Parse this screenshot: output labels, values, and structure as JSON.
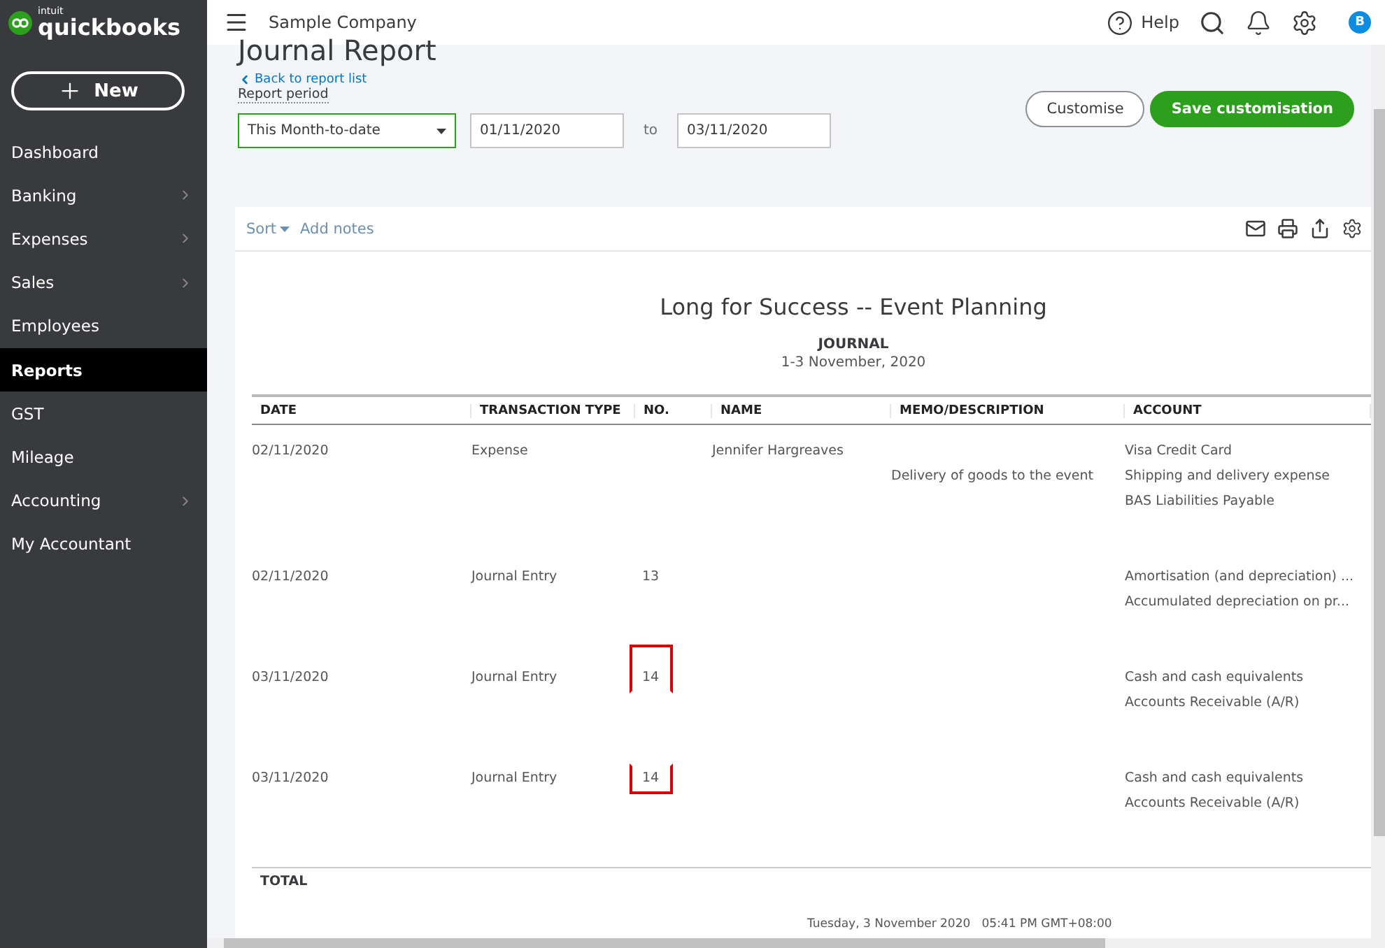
{
  "brand": {
    "small": "intuit",
    "name": "quickbooks"
  },
  "new_button": "New",
  "sidebar": {
    "items": [
      {
        "label": "Dashboard",
        "selected": false,
        "has_submenu": false
      },
      {
        "label": "Banking",
        "selected": false,
        "has_submenu": true
      },
      {
        "label": "Expenses",
        "selected": false,
        "has_submenu": true
      },
      {
        "label": "Sales",
        "selected": false,
        "has_submenu": true
      },
      {
        "label": "Employees",
        "selected": false,
        "has_submenu": false
      },
      {
        "label": "Reports",
        "selected": true,
        "has_submenu": false
      },
      {
        "label": "GST",
        "selected": false,
        "has_submenu": false
      },
      {
        "label": "Mileage",
        "selected": false,
        "has_submenu": false
      },
      {
        "label": "Accounting",
        "selected": false,
        "has_submenu": true
      },
      {
        "label": "My Accountant",
        "selected": false,
        "has_submenu": false
      }
    ]
  },
  "topbar": {
    "company": "Sample Company",
    "help": "Help",
    "avatar": "B"
  },
  "header": {
    "title": "Journal Report",
    "back_link": "Back to report list",
    "period_label": "Report period",
    "period_value": "This Month-to-date",
    "from": "01/11/2020",
    "to_label": "to",
    "to": "03/11/2020",
    "customise": "Customise",
    "save": "Save customisation"
  },
  "report_toolbar": {
    "sort": "Sort",
    "add_notes": "Add notes"
  },
  "report": {
    "company": "Long for Success -- Event Planning",
    "title": "JOURNAL",
    "period": "1-3 November, 2020",
    "columns": [
      "DATE",
      "TRANSACTION TYPE",
      "NO.",
      "NAME",
      "MEMO/DESCRIPTION",
      "ACCOUNT"
    ],
    "rows": [
      {
        "date": "02/11/2020",
        "type": "Expense",
        "marked": false,
        "lines": [
          {
            "name": "Jennifer Hargreaves",
            "account": "Visa Credit Card"
          },
          {
            "memo": "Delivery of goods to the event",
            "account": "Shipping and delivery expense"
          },
          {
            "account": "BAS Liabilities Payable"
          }
        ]
      },
      {
        "date": "02/11/2020",
        "type": "Journal Entry",
        "no": "13",
        "marked": false,
        "lines": [
          {
            "account": "Amortisation (and depreciation) ..."
          },
          {
            "account": "Accumulated depreciation on pr..."
          }
        ]
      },
      {
        "date": "03/11/2020",
        "type": "Journal Entry",
        "no": "14",
        "marked": true,
        "lines": [
          {
            "account": "Cash and cash equivalents"
          },
          {
            "account": "Accounts Receivable (A/R)"
          }
        ]
      },
      {
        "date": "03/11/2020",
        "type": "Journal Entry",
        "no": "14",
        "marked": true,
        "lines": [
          {
            "account": "Cash and cash equivalents"
          },
          {
            "account": "Accounts Receivable (A/R)"
          }
        ]
      }
    ],
    "total": "TOTAL",
    "footer": "Tuesday, 3 November 2020   05:41 PM GMT+08:00"
  }
}
